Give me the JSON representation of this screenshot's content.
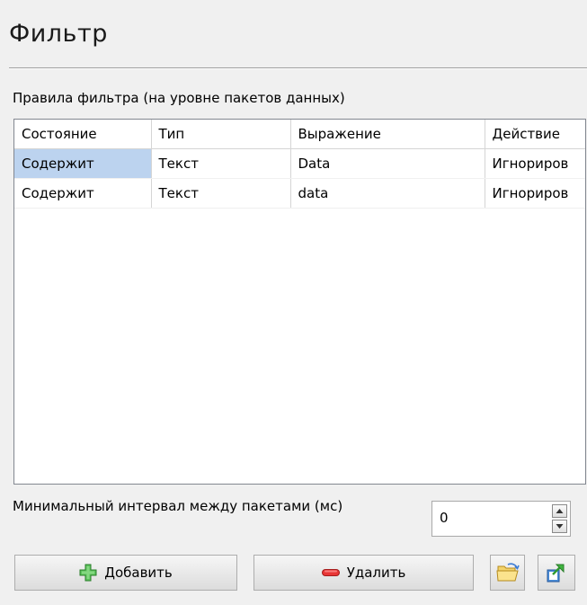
{
  "title": "Фильтр",
  "rules_label": "Правила фильтра (на уровне пакетов данных)",
  "table": {
    "headers": [
      "Состояние",
      "Тип",
      "Выражение",
      "Действие"
    ],
    "rows": [
      [
        "Содержит",
        "Текст",
        "Data",
        "Игнориров"
      ],
      [
        "Содержит",
        "Текст",
        "data",
        "Игнориров"
      ]
    ]
  },
  "interval": {
    "label": "Минимальный интервал между пакетами (мс)",
    "value": "0"
  },
  "buttons": {
    "add_label": "Добавить",
    "delete_label": "Удалить"
  },
  "icons": {
    "add": "plus-icon",
    "delete": "minus-icon",
    "open": "folder-open-icon",
    "export": "export-icon",
    "spin_up": "arrow-up-icon",
    "spin_down": "arrow-down-icon"
  },
  "colors": {
    "selection": "#bcd3ef",
    "add_icon": "#36a936",
    "delete_icon": "#e03030"
  }
}
